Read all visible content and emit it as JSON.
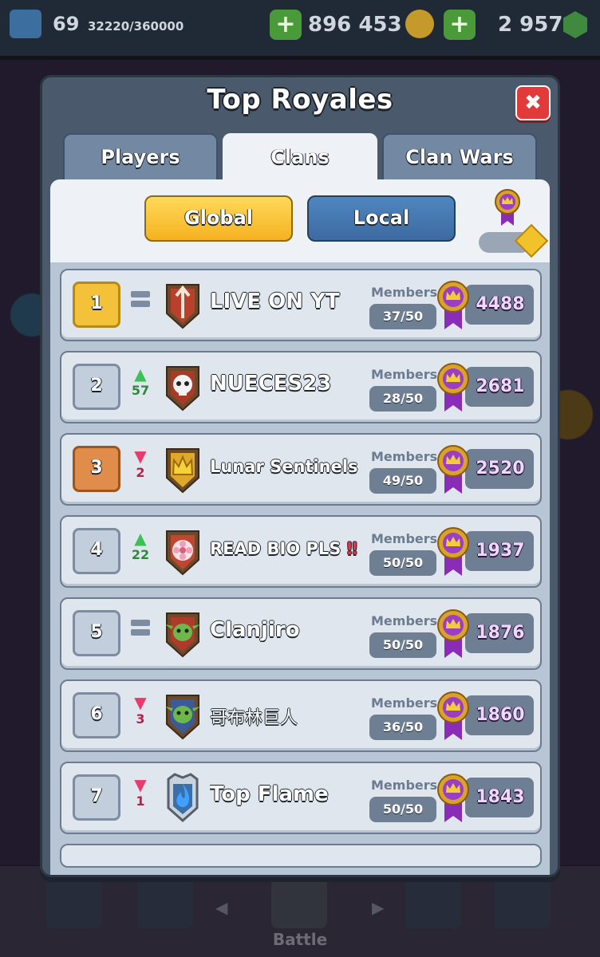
{
  "hud": {
    "level": "69",
    "xp": "32220/360000",
    "gold": "896 453",
    "gems": "2 957",
    "plus": "+"
  },
  "modal": {
    "title": "Top Royales",
    "close": "✖",
    "tabs": [
      {
        "label": "Players",
        "active": false
      },
      {
        "label": "Clans",
        "active": true
      },
      {
        "label": "Clan Wars",
        "active": false
      }
    ],
    "filters": {
      "global": "Global",
      "local": "Local"
    }
  },
  "labels": {
    "members": "Members"
  },
  "clans": [
    {
      "rank": "1",
      "change": "same",
      "change_value": "",
      "name": "LIVE ON YT",
      "members": "37/50",
      "trophies": "4488",
      "badge_color": "#b8402c",
      "badge_symbol": "arrow"
    },
    {
      "rank": "2",
      "change": "up",
      "change_value": "57",
      "name": "NUECES23",
      "members": "28/50",
      "trophies": "2681",
      "badge_color": "#a83a28",
      "badge_symbol": "skull"
    },
    {
      "rank": "3",
      "change": "down",
      "change_value": "2",
      "name": "Lunar Sentinels",
      "members": "49/50",
      "trophies": "2520",
      "badge_color": "#e0a828",
      "badge_symbol": "crown"
    },
    {
      "rank": "4",
      "change": "up",
      "change_value": "22",
      "name": "READ BIO PLS",
      "name_suffix": "‼",
      "members": "50/50",
      "trophies": "1937",
      "badge_color": "#c04632",
      "badge_symbol": "flower"
    },
    {
      "rank": "5",
      "change": "same",
      "change_value": "",
      "name": "Clanjiro",
      "members": "50/50",
      "trophies": "1876",
      "badge_color": "#b03a2a",
      "badge_symbol": "goblin"
    },
    {
      "rank": "6",
      "change": "down",
      "change_value": "3",
      "name": "哥布林巨人",
      "members": "36/50",
      "trophies": "1860",
      "badge_color": "#3a5a9a",
      "badge_symbol": "goblin"
    },
    {
      "rank": "7",
      "change": "down",
      "change_value": "1",
      "name": "Top Flame",
      "members": "50/50",
      "trophies": "1843",
      "badge_color": "#9aa6b5",
      "badge_symbol": "flame"
    }
  ],
  "bottom": {
    "battle": "Battle"
  },
  "colors": {
    "gold_rank": "#f4c23a",
    "bronze_rank": "#e08c4a",
    "trophy_purple": "#9b3ec4"
  }
}
